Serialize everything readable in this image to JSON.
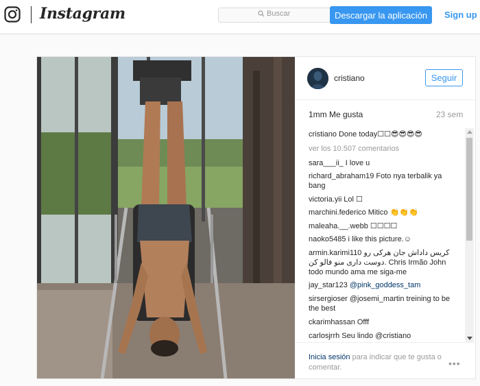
{
  "header": {
    "wordmark": "Instagram",
    "search_placeholder": "Buscar",
    "app_button": "Descargar la aplicación",
    "signup": "Sign up"
  },
  "post": {
    "username": "cristiano",
    "follow_label": "Seguir",
    "likes": "1mm Me gusta",
    "age": "23 sem"
  },
  "comments": {
    "caption_user": "cristiano",
    "caption_text": "Done today☐☐😎😎😎😎",
    "view_all": "ver los 10.507 comentarios",
    "items": [
      {
        "user": "sara___ii_",
        "text": "I love u"
      },
      {
        "user": "richard_abraham19",
        "text": "Foto nya terbalik ya bang"
      },
      {
        "user": "victoria.yii",
        "text": "Lol ☐"
      },
      {
        "user": "marchini.federico",
        "text": "Mitico 👏👏👏"
      },
      {
        "user": "maleaha.__.webb",
        "text": "☐☐☐☐"
      },
      {
        "user": "naoko5485",
        "text": "i like this picture.☺"
      },
      {
        "user": "armin.karimi110",
        "text": "کریس داداش جان هرکی رو دوست داری منو فالو کن. Chris Irmão John todo mundo ama me siga-me"
      },
      {
        "user": "jay_star123",
        "text": "@pink_goddess_tam"
      },
      {
        "user": "sirsergioser",
        "text": "@josemi_martin treining to be the best"
      },
      {
        "user": "ckarimhassan",
        "text": "Offf"
      },
      {
        "user": "carlosjrrh",
        "text": "Seu lindo @cristiano"
      }
    ]
  },
  "footer": {
    "login_link": "Inicia sesión",
    "login_rest": "para indicar que te gusta o comentar.",
    "more_glyph": "•••"
  },
  "colors": {
    "accent": "#3897f0",
    "link": "#003569",
    "muted": "#999999",
    "border": "#dbdbdb"
  }
}
